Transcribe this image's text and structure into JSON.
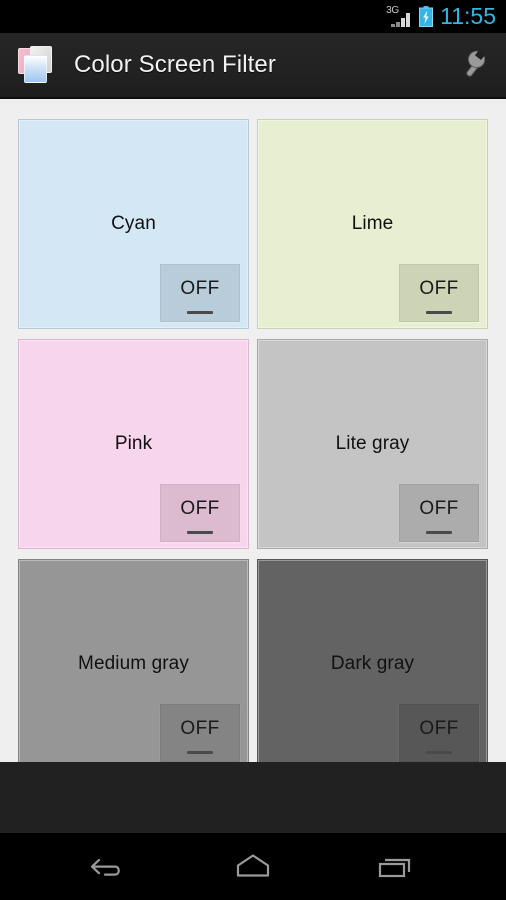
{
  "status_bar": {
    "network_label": "3G",
    "signal_icon": "signal-bars-icon",
    "battery_icon": "battery-charging-icon",
    "time": "11:55",
    "time_color": "#33B5E5"
  },
  "action_bar": {
    "app_icon": "color-screen-filter-app-icon",
    "title": "Color Screen Filter",
    "settings_icon": "wrench-icon"
  },
  "filters": [
    {
      "name": "Cyan",
      "toggle_label": "OFF",
      "state": "off",
      "color": "#D3E7F4",
      "button_color": "#B8CDD9",
      "label_position": "top"
    },
    {
      "name": "Lime",
      "toggle_label": "OFF",
      "state": "off",
      "color": "#E8EFD1",
      "button_color": "#CDD4B6",
      "label_position": "top"
    },
    {
      "name": "Pink",
      "toggle_label": "OFF",
      "state": "off",
      "color": "#F7D5EC",
      "button_color": "#DCBBD1",
      "label_position": "center"
    },
    {
      "name": "Lite gray",
      "toggle_label": "OFF",
      "state": "off",
      "color": "#C4C4C4",
      "button_color": "#ACACAC",
      "label_position": "center"
    },
    {
      "name": "Medium gray",
      "toggle_label": "OFF",
      "state": "off",
      "color": "#969696",
      "button_color": "#848484",
      "label_position": "center"
    },
    {
      "name": "Dark gray",
      "toggle_label": "OFF",
      "state": "off",
      "color": "#636363",
      "button_color": "#575757",
      "label_position": "center"
    }
  ],
  "nav_bar": {
    "back": "back-icon",
    "home": "home-icon",
    "recents": "recents-icon"
  }
}
